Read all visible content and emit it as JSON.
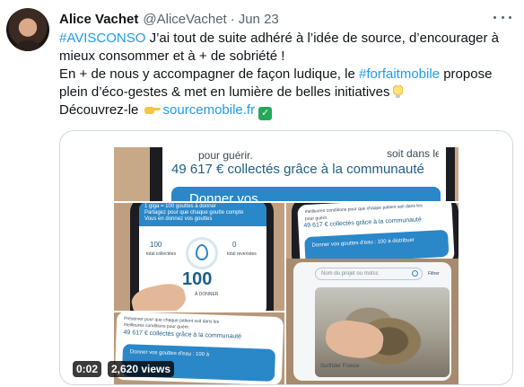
{
  "tweet": {
    "author_name": "Alice Vachet",
    "handle": "@AliceVachet",
    "separator": "·",
    "date": "Jun 23",
    "line1_tag": "#AVISCONSO",
    "line1_text": " J’ai tout de suite adhéré à l’idée de source, d’encourager à",
    "line2_text": "mieux consommer et à + de sobriété !",
    "line3_text": "En + de nous y accompagner de façon ludique, le ",
    "line3_tag": "#forfaitmobile",
    "line3_tail": " propose",
    "line4_text": "plein d’éco-gestes & met en lumière de belles initiatives",
    "line5_text": "Découvrez-le ",
    "line5_link": "sourcemobile.fr",
    "check_glyph": "✓",
    "bulb_icon": "light-bulb-icon",
    "pointing_icon": "pointing-hand-icon"
  },
  "media": {
    "time": "0:02",
    "views": "2,620 views",
    "top_banner_big": "49 617 € collectés grâce à la communauté",
    "top_banner_line": "pour guérir.",
    "top_banner_right": "soit dans les",
    "top_button": "Donner vos",
    "tile_ml_header": "1 giga = 100 gouttes à donner",
    "tile_ml_sub": "Partagez pour que chaque goutte compte",
    "tile_ml_sub2": "Vous en donnez vos gouttes",
    "tile_ml_num1": "100",
    "tile_ml_num1_label": "total collectées",
    "tile_ml_num2": "0",
    "tile_ml_num2_label": "total reversées",
    "tile_ml_big": "100",
    "tile_ml_cta": "À DONNER",
    "tile_mr_line1": "meilleures conditions pour que chaque patient soit dans les",
    "tile_mr_line2": "pour guérir.",
    "tile_mr_big": "49 617 € collectés grâce à la communauté",
    "tile_mr_button": "Donner vos gouttes d'eau : 100 à distribuer",
    "tile_br_search": "Nom du projet ou motsc",
    "tile_br_filter": "Filtrer",
    "tile_br_caption": "Surfrider France",
    "tile_bl_line1": "Préserver pour que chaque patient soit dans les",
    "tile_bl_line2": "meilleures conditions pour guérir.",
    "tile_bl_big": "49 617 € collectés grâce à la communauté",
    "tile_bl_button": "Donner vos gouttes d'eau : 100 à"
  }
}
